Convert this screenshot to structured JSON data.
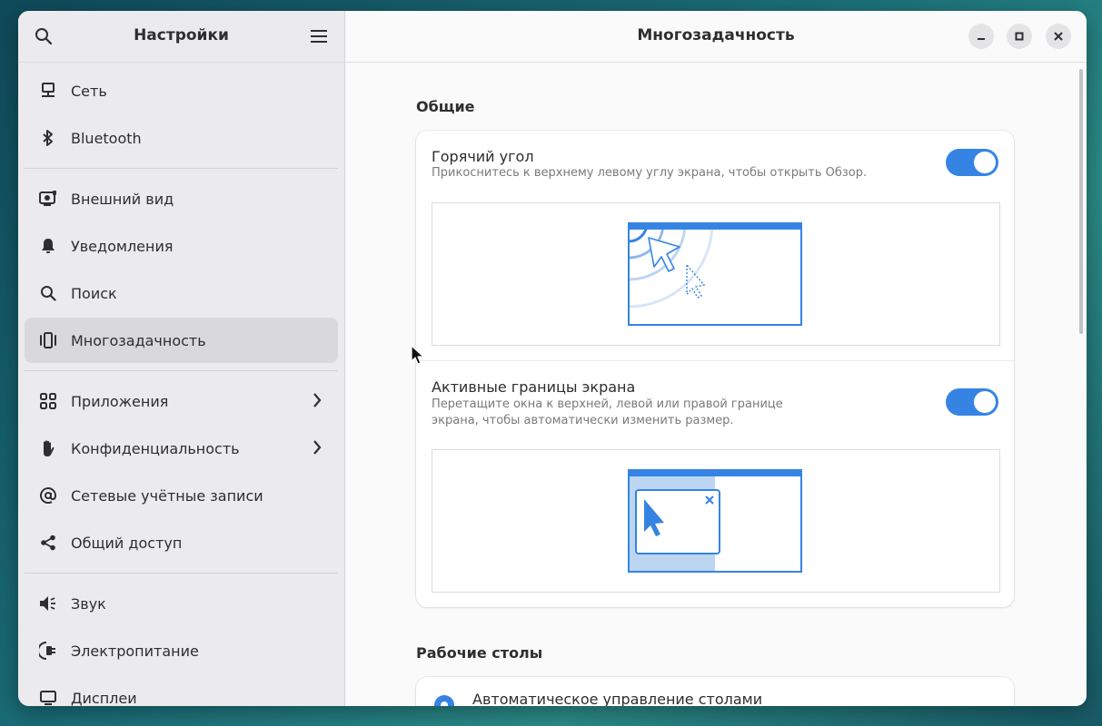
{
  "sidebar": {
    "title": "Настройки",
    "items": [
      {
        "label": "Сеть",
        "icon": "network-icon"
      },
      {
        "label": "Bluetooth",
        "icon": "bluetooth-icon"
      },
      {
        "label": "Внешний вид",
        "icon": "appearance-icon"
      },
      {
        "label": "Уведомления",
        "icon": "bell-icon"
      },
      {
        "label": "Поиск",
        "icon": "search-icon"
      },
      {
        "label": "Многозадачность",
        "icon": "multitasking-icon",
        "active": true
      },
      {
        "label": "Приложения",
        "icon": "apps-grid-icon"
      },
      {
        "label": "Конфиденциальность",
        "icon": "hand-icon"
      },
      {
        "label": "Сетевые учётные записи",
        "icon": "at-icon"
      },
      {
        "label": "Общий доступ",
        "icon": "share-icon"
      },
      {
        "label": "Звук",
        "icon": "speaker-icon"
      },
      {
        "label": "Электропитание",
        "icon": "power-icon"
      },
      {
        "label": "Дисплеи",
        "icon": "display-icon"
      }
    ]
  },
  "main": {
    "title": "Многозадачность",
    "general": {
      "section_title": "Общие",
      "hot_corner": {
        "title": "Горячий угол",
        "subtitle": "Прикоснитесь к верхнему левому углу экрана, чтобы открыть Обзор.",
        "enabled": true
      },
      "active_edges": {
        "title": "Активные границы экрана",
        "subtitle_line1": "Перетащите окна к верхней, левой или правой границе",
        "subtitle_line2": "экрана, чтобы автоматически изменить размер.",
        "enabled": true
      }
    },
    "workspaces": {
      "section_title": "Рабочие столы",
      "dynamic": {
        "title": "Автоматическое управление столами",
        "selected": true
      }
    }
  },
  "colors": {
    "accent": "#3584e4",
    "preview_light": "#bcd6f2"
  }
}
